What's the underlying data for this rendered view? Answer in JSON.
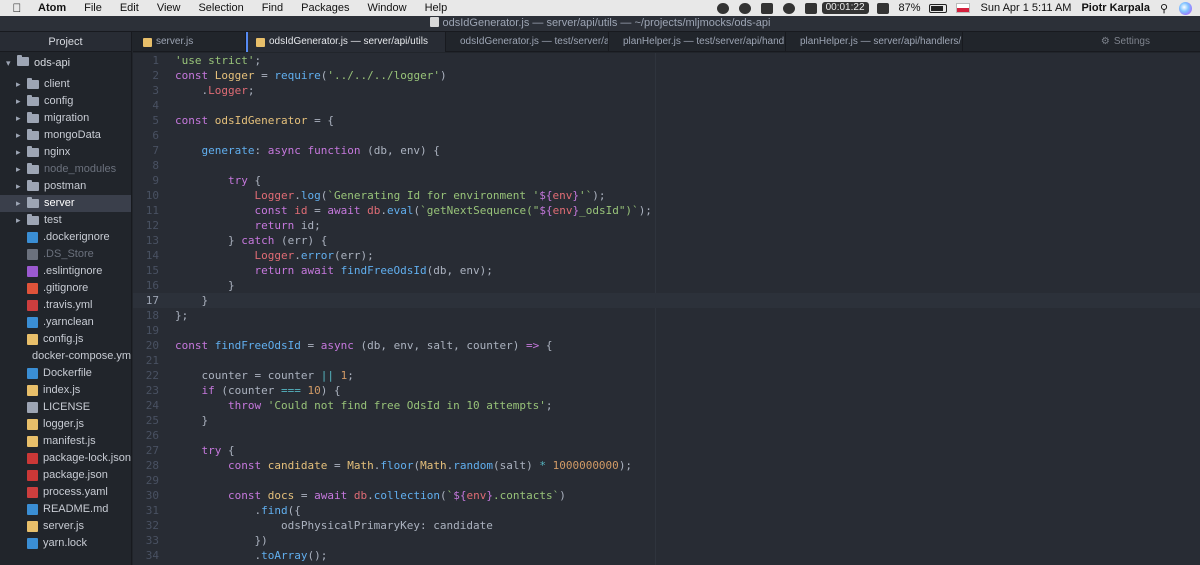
{
  "menubar": {
    "items": [
      "Atom",
      "File",
      "Edit",
      "View",
      "Selection",
      "Find",
      "Packages",
      "Window",
      "Help"
    ],
    "timer": "00:01:22",
    "battery": "87%",
    "battery_level": 0.87,
    "clock": "Sun Apr 1  5:11 AM",
    "user": "Piotr Karpala"
  },
  "window": {
    "title": "odsIdGenerator.js — server/api/utils — ~/projects/mljmocks/ods-api"
  },
  "tree": {
    "panel_title": "Project",
    "root": "ods-api",
    "items": [
      {
        "type": "dir",
        "label": "client"
      },
      {
        "type": "dir",
        "label": "config"
      },
      {
        "type": "dir",
        "label": "migration"
      },
      {
        "type": "dir",
        "label": "mongoData"
      },
      {
        "type": "dir",
        "label": "nginx"
      },
      {
        "type": "dir",
        "label": "node_modules",
        "dim": true
      },
      {
        "type": "dir",
        "label": "postman"
      },
      {
        "type": "dir",
        "label": "server",
        "selected": true
      },
      {
        "type": "dir",
        "label": "test"
      },
      {
        "type": "file",
        "label": ".dockerignore",
        "icon": "docker-icon",
        "color": "#3a8ed4"
      },
      {
        "type": "file",
        "label": ".DS_Store",
        "icon": "file-icon",
        "color": "#6b717d",
        "dim": true
      },
      {
        "type": "file",
        "label": ".eslintignore",
        "icon": "eslint-icon",
        "color": "#9b59d0"
      },
      {
        "type": "file",
        "label": ".gitignore",
        "icon": "git-icon",
        "color": "#e0533a"
      },
      {
        "type": "file",
        "label": ".travis.yml",
        "icon": "travis-icon",
        "color": "#cd3e3e"
      },
      {
        "type": "file",
        "label": ".yarnclean",
        "icon": "yarn-icon",
        "color": "#3a8ed4"
      },
      {
        "type": "file",
        "label": "config.js",
        "icon": "js-icon",
        "color": "#e8bf6a"
      },
      {
        "type": "file",
        "label": "docker-compose.yml",
        "icon": "docker-icon",
        "color": "#3a8ed4"
      },
      {
        "type": "file",
        "label": "Dockerfile",
        "icon": "docker-icon",
        "color": "#3a8ed4"
      },
      {
        "type": "file",
        "label": "index.js",
        "icon": "js-icon",
        "color": "#e8bf6a"
      },
      {
        "type": "file",
        "label": "LICENSE",
        "icon": "license-icon",
        "color": "#9da5b4"
      },
      {
        "type": "file",
        "label": "logger.js",
        "icon": "js-icon",
        "color": "#e8bf6a"
      },
      {
        "type": "file",
        "label": "manifest.js",
        "icon": "js-icon",
        "color": "#e8bf6a"
      },
      {
        "type": "file",
        "label": "package-lock.json",
        "icon": "npm-icon",
        "color": "#cb3837"
      },
      {
        "type": "file",
        "label": "package.json",
        "icon": "npm-icon",
        "color": "#cb3837"
      },
      {
        "type": "file",
        "label": "process.yaml",
        "icon": "yaml-icon",
        "color": "#cd3e3e"
      },
      {
        "type": "file",
        "label": "README.md",
        "icon": "markdown-icon",
        "color": "#3a8ed4"
      },
      {
        "type": "file",
        "label": "server.js",
        "icon": "js-icon",
        "color": "#e8bf6a"
      },
      {
        "type": "file",
        "label": "yarn.lock",
        "icon": "yarn-icon",
        "color": "#3a8ed4"
      }
    ]
  },
  "tabs": [
    {
      "label": "server.js",
      "active": false
    },
    {
      "label": "odsIdGenerator.js — server/api/utils",
      "active": true
    },
    {
      "label": "odsIdGenerator.js — test/server/api/...",
      "active": false
    },
    {
      "label": "planHelper.js — test/server/api/hand...",
      "active": false
    },
    {
      "label": "planHelper.js — server/api/handlers/...",
      "active": false
    }
  ],
  "settings_tab": "Settings",
  "editor": {
    "cursor_line": 17,
    "lines": [
      [
        [
          "s",
          "'use strict'"
        ],
        [
          "p",
          ";"
        ]
      ],
      [
        [
          "k",
          "const "
        ],
        [
          "c",
          "Logger"
        ],
        [
          "p",
          " = "
        ],
        [
          "f",
          "require"
        ],
        [
          "p",
          "("
        ],
        [
          "s",
          "'../../../logger'"
        ],
        [
          "p",
          ")"
        ]
      ],
      [
        [
          "p",
          "    ."
        ],
        [
          "v",
          "Logger"
        ],
        [
          "p",
          ";"
        ]
      ],
      [],
      [
        [
          "k",
          "const "
        ],
        [
          "c",
          "odsIdGenerator"
        ],
        [
          "p",
          " = {"
        ]
      ],
      [],
      [
        [
          "p",
          "    "
        ],
        [
          "f",
          "generate"
        ],
        [
          "p",
          ": "
        ],
        [
          "k",
          "async function "
        ],
        [
          "p",
          "(db, env) {"
        ]
      ],
      [],
      [
        [
          "p",
          "        "
        ],
        [
          "k",
          "try "
        ],
        [
          "p",
          "{"
        ]
      ],
      [
        [
          "p",
          "            "
        ],
        [
          "v",
          "Logger"
        ],
        [
          "p",
          "."
        ],
        [
          "f",
          "log"
        ],
        [
          "p",
          "("
        ],
        [
          "s",
          "`Generating Id for environment '"
        ],
        [
          "k",
          "${"
        ],
        [
          "v",
          "env"
        ],
        [
          "k",
          "}"
        ],
        [
          "s",
          "'`"
        ],
        [
          "p",
          ");"
        ]
      ],
      [
        [
          "p",
          "            "
        ],
        [
          "k",
          "const "
        ],
        [
          "v",
          "id"
        ],
        [
          "p",
          " = "
        ],
        [
          "k",
          "await "
        ],
        [
          "v",
          "db"
        ],
        [
          "p",
          "."
        ],
        [
          "f",
          "eval"
        ],
        [
          "p",
          "("
        ],
        [
          "s",
          "`getNextSequence(\""
        ],
        [
          "k",
          "${"
        ],
        [
          "v",
          "env"
        ],
        [
          "k",
          "}"
        ],
        [
          "s",
          "_odsId\")`"
        ],
        [
          "p",
          ");"
        ]
      ],
      [
        [
          "p",
          "            "
        ],
        [
          "k",
          "return "
        ],
        [
          "p",
          "id;"
        ]
      ],
      [
        [
          "p",
          "        } "
        ],
        [
          "k",
          "catch "
        ],
        [
          "p",
          "(err) {"
        ]
      ],
      [
        [
          "p",
          "            "
        ],
        [
          "v",
          "Logger"
        ],
        [
          "p",
          "."
        ],
        [
          "f",
          "error"
        ],
        [
          "p",
          "(err);"
        ]
      ],
      [
        [
          "p",
          "            "
        ],
        [
          "k",
          "return await "
        ],
        [
          "f",
          "findFreeOdsId"
        ],
        [
          "p",
          "(db, env);"
        ]
      ],
      [
        [
          "p",
          "        }"
        ]
      ],
      [
        [
          "p",
          "    }"
        ]
      ],
      [
        [
          "p",
          "};"
        ]
      ],
      [],
      [
        [
          "k",
          "const "
        ],
        [
          "f",
          "findFreeOdsId"
        ],
        [
          "p",
          " = "
        ],
        [
          "k",
          "async "
        ],
        [
          "p",
          "(db, env, salt, counter) "
        ],
        [
          "k",
          "=>"
        ],
        [
          "p",
          " {"
        ]
      ],
      [],
      [
        [
          "p",
          "    counter = counter "
        ],
        [
          "o",
          "||"
        ],
        [
          "p",
          " "
        ],
        [
          "n",
          "1"
        ],
        [
          "p",
          ";"
        ]
      ],
      [
        [
          "p",
          "    "
        ],
        [
          "k",
          "if "
        ],
        [
          "p",
          "(counter "
        ],
        [
          "o",
          "==="
        ],
        [
          "p",
          " "
        ],
        [
          "n",
          "10"
        ],
        [
          "p",
          ") {"
        ]
      ],
      [
        [
          "p",
          "        "
        ],
        [
          "k",
          "throw "
        ],
        [
          "s",
          "'Could not find free OdsId in 10 attempts'"
        ],
        [
          "p",
          ";"
        ]
      ],
      [
        [
          "p",
          "    }"
        ]
      ],
      [],
      [
        [
          "p",
          "    "
        ],
        [
          "k",
          "try "
        ],
        [
          "p",
          "{"
        ]
      ],
      [
        [
          "p",
          "        "
        ],
        [
          "k",
          "const "
        ],
        [
          "c",
          "candidate"
        ],
        [
          "p",
          " = "
        ],
        [
          "c",
          "Math"
        ],
        [
          "p",
          "."
        ],
        [
          "f",
          "floor"
        ],
        [
          "p",
          "("
        ],
        [
          "c",
          "Math"
        ],
        [
          "p",
          "."
        ],
        [
          "f",
          "random"
        ],
        [
          "p",
          "(salt) "
        ],
        [
          "o",
          "*"
        ],
        [
          "p",
          " "
        ],
        [
          "n",
          "1000000000"
        ],
        [
          "p",
          ");"
        ]
      ],
      [],
      [
        [
          "p",
          "        "
        ],
        [
          "k",
          "const "
        ],
        [
          "c",
          "docs"
        ],
        [
          "p",
          " = "
        ],
        [
          "k",
          "await "
        ],
        [
          "v",
          "db"
        ],
        [
          "p",
          "."
        ],
        [
          "f",
          "collection"
        ],
        [
          "p",
          "("
        ],
        [
          "s",
          "`"
        ],
        [
          "k",
          "${"
        ],
        [
          "v",
          "env"
        ],
        [
          "k",
          "}"
        ],
        [
          "s",
          ".contacts`"
        ],
        [
          "p",
          ")"
        ]
      ],
      [
        [
          "p",
          "            ."
        ],
        [
          "f",
          "find"
        ],
        [
          "p",
          "({"
        ]
      ],
      [
        [
          "p",
          "                odsPhysicalPrimaryKey: candidate"
        ]
      ],
      [
        [
          "p",
          "            })"
        ]
      ],
      [
        [
          "p",
          "            ."
        ],
        [
          "f",
          "toArray"
        ],
        [
          "p",
          "();"
        ]
      ]
    ]
  }
}
